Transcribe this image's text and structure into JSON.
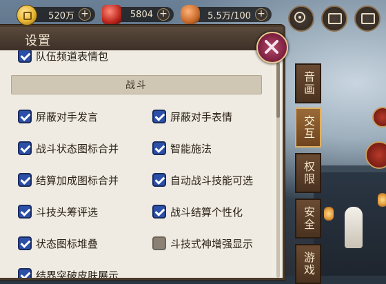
{
  "resources": [
    {
      "icon": "gold-coin-icon",
      "value": "520万"
    },
    {
      "icon": "jade-icon",
      "value": "5804"
    },
    {
      "icon": "stamina-food-icon",
      "value": "5.5万/100"
    }
  ],
  "top_buttons": [
    "mail-icon",
    "mail-icon"
  ],
  "panel": {
    "title": "设置",
    "cut_off_top_label": "队伍频道表情包",
    "section_title": "战斗",
    "options": [
      {
        "label": "屏蔽对手发言",
        "checked": true
      },
      {
        "label": "屏蔽对手表情",
        "checked": true
      },
      {
        "label": "战斗状态图标合并",
        "checked": true
      },
      {
        "label": "智能施法",
        "checked": true
      },
      {
        "label": "结算加成图标合并",
        "checked": true
      },
      {
        "label": "自动战斗技能可选",
        "checked": true
      },
      {
        "label": "斗技头筹评选",
        "checked": true
      },
      {
        "label": "战斗结算个性化",
        "checked": true
      },
      {
        "label": "状态图标堆叠",
        "checked": true
      },
      {
        "label": "斗技式神增强显示",
        "checked": false
      },
      {
        "label": "结界突破皮肤展示",
        "checked": true
      }
    ]
  },
  "tabs": [
    {
      "label": "音画",
      "active": false
    },
    {
      "label": "交互",
      "active": true
    },
    {
      "label": "权限",
      "active": false
    },
    {
      "label": "安全",
      "active": false
    },
    {
      "label": "游戏",
      "active": false
    }
  ],
  "colors": {
    "checkbox_on": "#2c50a8",
    "checkbox_off": "#8a8074",
    "panel_bg": "#efebe2",
    "tab_active": "#9a6a38"
  }
}
